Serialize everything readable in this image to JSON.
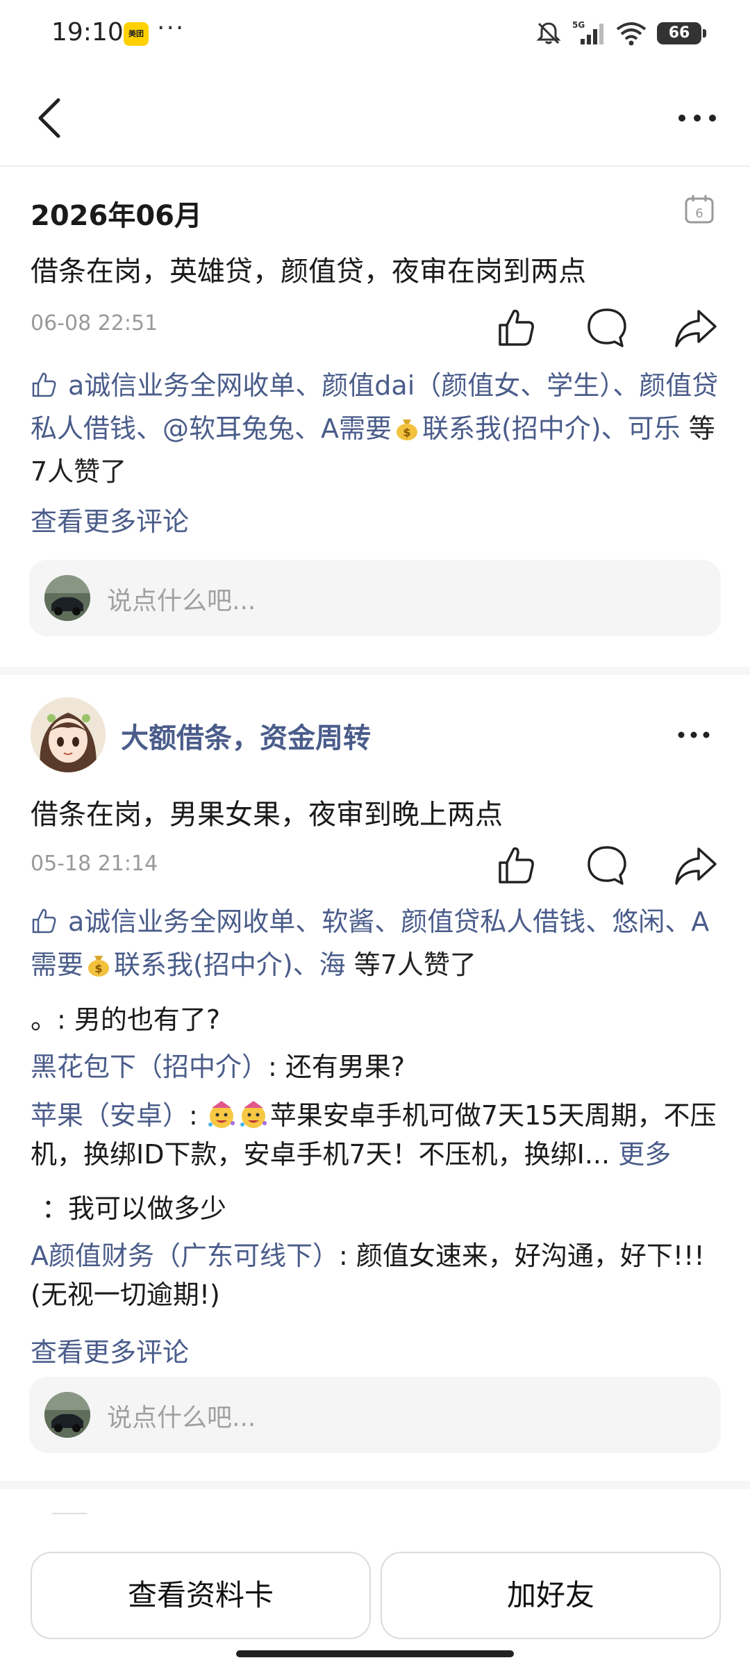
{
  "status_bar": {
    "time": "19:10",
    "app_badge": "美团",
    "network": "5G",
    "battery": "66"
  },
  "post1": {
    "date_title": "2026年06月",
    "calendar_day": "6",
    "text": "借条在岗，英雄贷，颜值贷，夜审在岗到两点",
    "time": "06-08 22:51",
    "likes": {
      "names_part1": "a诚信业务全网收单、颜值dai（颜值女、学生）、颜值贷私人借钱、@软耳兔兔、A需要",
      "names_part2": "联系我(招中介)、可乐",
      "suffix": " 等7人赞了"
    },
    "more_comments": "查看更多评论",
    "comment_placeholder": "说点什么吧..."
  },
  "post2": {
    "author": "大额借条，资金周转",
    "text": "借条在岗，男果女果，夜审到晚上两点",
    "time": "05-18 21:14",
    "likes": {
      "names_part1": "a诚信业务全网收单、软酱、颜值贷私人借钱、悠闲、A需要",
      "names_part2": "联系我(招中介)、海",
      "suffix": " 等7人赞了"
    },
    "comments": [
      {
        "name": "。",
        "text": ": 男的也有了?"
      },
      {
        "name": "黑花包下（招中介）",
        "text": ": 还有男果?"
      },
      {
        "name": "苹果（安卓）",
        "text": ": ",
        "text2": "苹果安卓手机可做7天15天周期，不压机，换绑ID下款，安卓手机7天！不压机，换绑I...",
        "more": "更多"
      },
      {
        "name": "",
        "text": "：我可以做多少"
      },
      {
        "name": "A颜值财务（广东可线下）",
        "text": ": 颜值女速来，好沟通，好下!!!(无视一切逾期!)"
      }
    ],
    "more_comments": "查看更多评论",
    "comment_placeholder": "说点什么吧..."
  },
  "bottom_bar": {
    "profile_button": "查看资料卡",
    "add_friend_button": "加好友"
  }
}
